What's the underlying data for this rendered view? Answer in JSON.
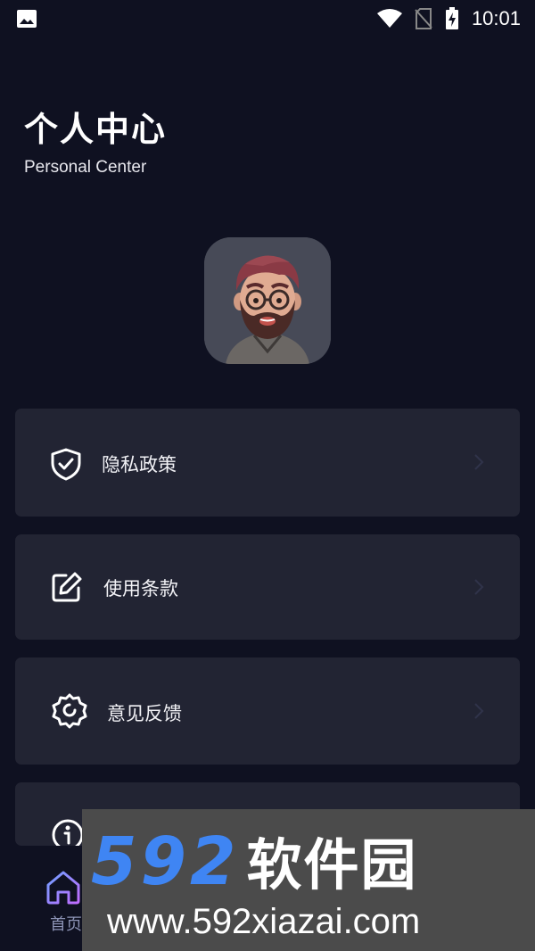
{
  "status_bar": {
    "time": "10:01"
  },
  "header": {
    "title": "个人中心",
    "subtitle": "Personal Center"
  },
  "menu": {
    "items": [
      {
        "label": "隐私政策",
        "icon": "shield-check-icon"
      },
      {
        "label": "使用条款",
        "icon": "edit-icon"
      },
      {
        "label": "意见反馈",
        "icon": "gear-icon"
      },
      {
        "label": "",
        "icon": "info-icon"
      }
    ]
  },
  "tab_bar": {
    "items": [
      {
        "label": "首页",
        "icon": "home-icon"
      }
    ]
  },
  "watermark": {
    "logo_digits": "592",
    "logo_text": "软件园",
    "url": "www.592xiazai.com"
  },
  "colors": {
    "background": "#0f1121",
    "card": "#222433",
    "accent": "#3f85f3"
  }
}
